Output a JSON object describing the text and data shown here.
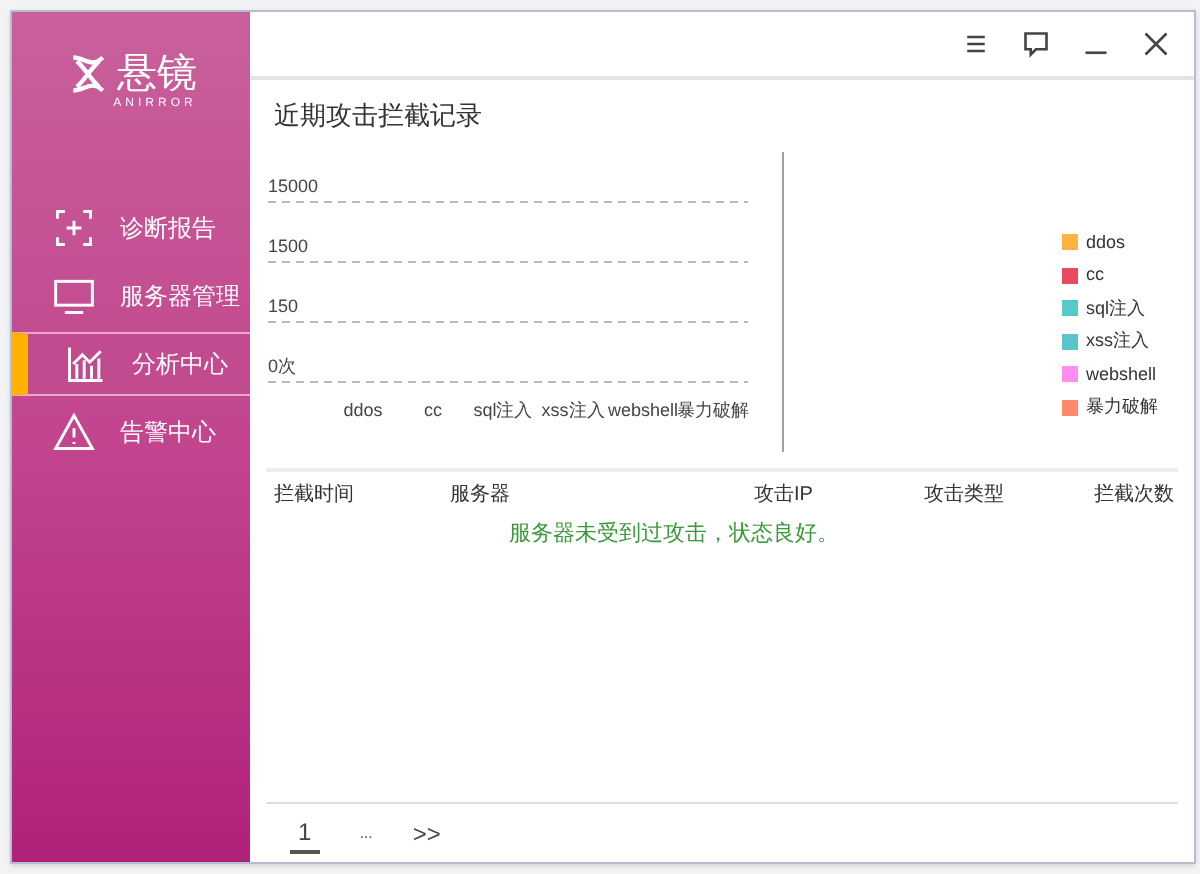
{
  "logo": {
    "name": "悬镜",
    "subtitle": "ANIRROR"
  },
  "window_controls": [
    {
      "kind": "menu"
    },
    {
      "kind": "feedback"
    },
    {
      "kind": "minimize"
    },
    {
      "kind": "close"
    }
  ],
  "sidebar": {
    "items": [
      {
        "label": "诊断报告",
        "kind": "report",
        "selected": false
      },
      {
        "label": "服务器管理",
        "kind": "server",
        "selected": false
      },
      {
        "label": "分析中心",
        "kind": "chart",
        "selected": true
      },
      {
        "label": "告警中心",
        "kind": "warning",
        "selected": false
      }
    ]
  },
  "section_title": "近期攻击拦截记录",
  "chart": {
    "x_labels": [
      "ddos",
      "cc",
      "sql注入",
      "xss注入",
      "webshell",
      "暴力破解"
    ],
    "y_labels": [
      "15000",
      "1500",
      "150",
      "0次"
    ],
    "legend": [
      {
        "name": "ddos",
        "color": "#ffb23f"
      },
      {
        "name": "cc",
        "color": "#e84a5f"
      },
      {
        "name": "sql注入",
        "color": "#5bc8c8"
      },
      {
        "name": "xss注入",
        "color": "#5ac4cc"
      },
      {
        "name": "webshell",
        "color": "#ff8ef0"
      },
      {
        "name": "暴力破解",
        "color": "#ff8a6a"
      }
    ]
  },
  "table": {
    "columns": [
      "拦截时间",
      "服务器",
      "攻击IP",
      "攻击类型",
      "拦截次数"
    ],
    "empty_message": "服务器未受到过攻击，状态良好。"
  },
  "pagination": [
    {
      "label": "1",
      "kind": "page",
      "selected": true
    },
    {
      "label": "...",
      "kind": "ellipsis",
      "selected": false
    },
    {
      "label": ">>",
      "kind": "next",
      "selected": false
    }
  ]
}
